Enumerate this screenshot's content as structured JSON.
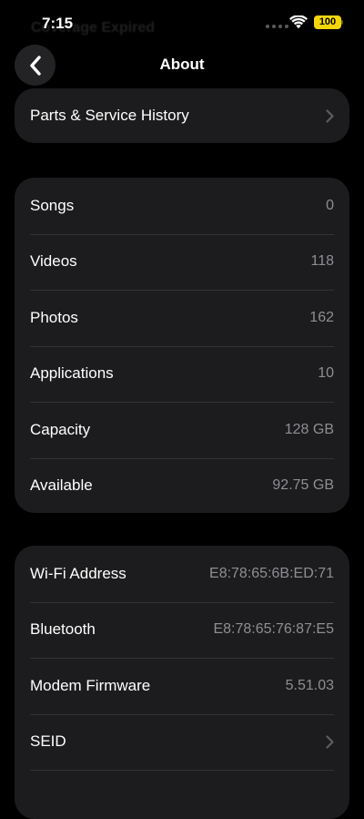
{
  "status_bar": {
    "time": "7:15",
    "ghost_title": "Coverage Expired",
    "battery": "100"
  },
  "nav": {
    "title": "About"
  },
  "sections": {
    "parts": [
      {
        "label": "Parts & Service History",
        "chevron": true
      }
    ],
    "media": [
      {
        "label": "Songs",
        "value": "0"
      },
      {
        "label": "Videos",
        "value": "118"
      },
      {
        "label": "Photos",
        "value": "162"
      },
      {
        "label": "Applications",
        "value": "10"
      },
      {
        "label": "Capacity",
        "value": "128 GB"
      },
      {
        "label": "Available",
        "value": "92.75 GB"
      }
    ],
    "network": [
      {
        "label": "Wi-Fi Address",
        "value": "E8:78:65:6B:ED:71"
      },
      {
        "label": "Bluetooth",
        "value": "E8:78:65:76:87:E5"
      },
      {
        "label": "Modem Firmware",
        "value": "5.51.03"
      },
      {
        "label": "SEID",
        "chevron": true
      }
    ]
  },
  "icons": {
    "back": "chevron-left-icon",
    "row_chevron": "chevron-right-icon",
    "wifi": "wifi-icon",
    "battery": "battery-icon"
  },
  "colors": {
    "background": "#000000",
    "card": "#1c1c1e",
    "secondary_text": "#8e8e93",
    "battery": "#f5d60a"
  }
}
